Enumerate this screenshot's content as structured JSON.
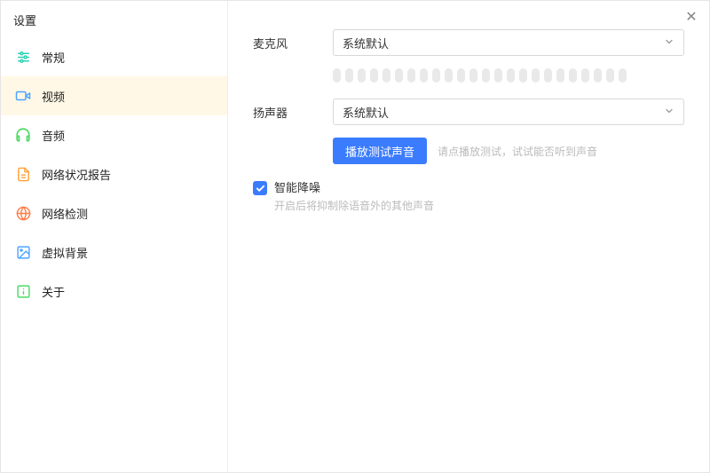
{
  "title": "设置",
  "sidebar": {
    "items": [
      {
        "label": "常规"
      },
      {
        "label": "视频"
      },
      {
        "label": "音频"
      },
      {
        "label": "网络状况报告"
      },
      {
        "label": "网络检测"
      },
      {
        "label": "虚拟背景"
      },
      {
        "label": "关于"
      }
    ],
    "active_index": 1
  },
  "content": {
    "microphone_label": "麦克风",
    "microphone_value": "系统默认",
    "speaker_label": "扬声器",
    "speaker_value": "系统默认",
    "test_button_label": "播放测试声音",
    "test_hint": "请点播放测试，试试能否听到声音",
    "noise_label": "智能降噪",
    "noise_desc": "开启后将抑制除语音外的其他声音",
    "meter_bars": 24
  },
  "colors": {
    "primary": "#3b7cff",
    "icon_teal": "#2bd1b3",
    "icon_blue": "#4fa3ff",
    "icon_green": "#4cd964",
    "icon_orange": "#ffa032",
    "icon_redorange": "#ff7a45"
  }
}
